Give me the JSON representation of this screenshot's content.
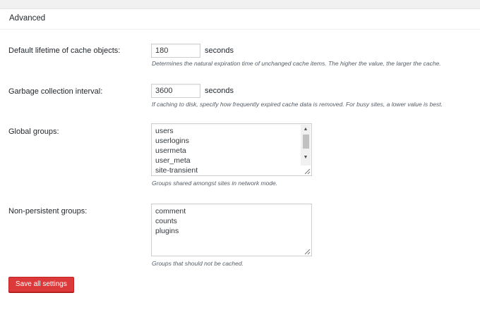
{
  "panel": {
    "title": "Advanced"
  },
  "fields": {
    "default_lifetime": {
      "label": "Default lifetime of cache objects:",
      "value": "180",
      "unit": "seconds",
      "description": "Determines the natural expiration time of unchanged cache items. The higher the value, the larger the cache."
    },
    "gc_interval": {
      "label": "Garbage collection interval:",
      "value": "3600",
      "unit": "seconds",
      "description": "If caching to disk, specify how frequently expired cache data is removed. For busy sites, a lower value is best."
    },
    "global_groups": {
      "label": "Global groups:",
      "lines": [
        "users",
        "userlogins",
        "usermeta",
        "user_meta",
        "site-transient"
      ],
      "description": "Groups shared amongst sites in network mode."
    },
    "non_persistent_groups": {
      "label": "Non-persistent groups:",
      "lines": [
        "comment",
        "counts",
        "plugins"
      ],
      "description": "Groups that should not be cached."
    }
  },
  "buttons": {
    "save_label": "Save all settings"
  },
  "colors": {
    "button_bg": "#dc3a3a",
    "button_border": "#c42020",
    "text": "#23282d",
    "description": "#555d66"
  }
}
